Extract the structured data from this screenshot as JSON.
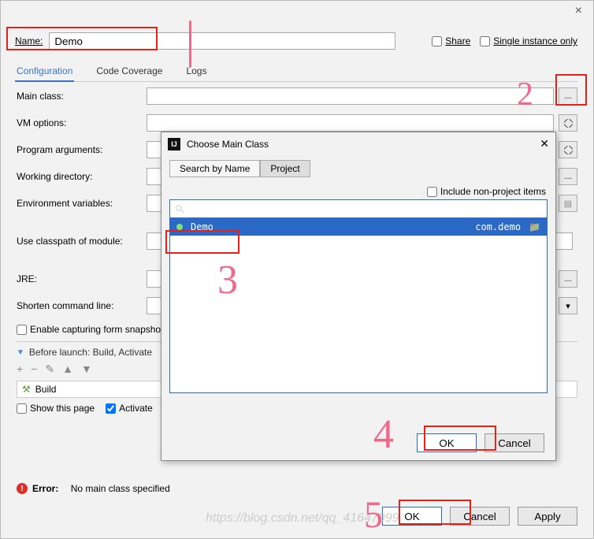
{
  "top": {
    "name_label": "Name:",
    "name_value": "Demo",
    "share": "Share",
    "single": "Single instance only"
  },
  "tabs": {
    "config": "Configuration",
    "coverage": "Code Coverage",
    "logs": "Logs"
  },
  "labels": {
    "main_class": "Main class:",
    "vm": "VM options:",
    "prog": "Program arguments:",
    "wdir": "Working directory:",
    "env": "Environment variables:",
    "classpath": "Use classpath of module:",
    "jre": "JRE:",
    "shorten": "Shorten command line:",
    "enable_capture": "Enable capturing form snapshots"
  },
  "before": {
    "header": "Before launch: Build, Activate",
    "build": "Build",
    "show": "Show this page",
    "activate": "Activate"
  },
  "error": {
    "label": "Error:",
    "msg": "No main class specified"
  },
  "buttons": {
    "ok": "OK",
    "cancel": "Cancel",
    "apply": "Apply"
  },
  "modal": {
    "title": "Choose Main Class",
    "tab1": "Search by Name",
    "tab2": "Project",
    "include": "Include non-project items",
    "result_name": "Demo",
    "result_pkg": "com.demo",
    "ok": "OK",
    "cancel": "Cancel"
  },
  "ann": {
    "n1": "1",
    "n2": "2",
    "n3": "3",
    "n4": "4",
    "n5": "5"
  },
  "watermark": "https://blog.csdn.net/qq_41647999"
}
